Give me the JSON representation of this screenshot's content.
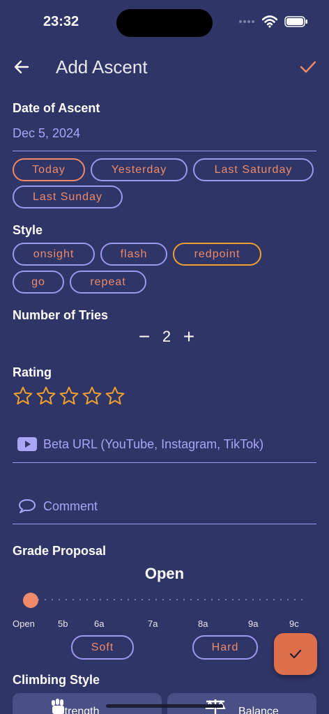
{
  "status_bar": {
    "time": "23:32"
  },
  "app_bar": {
    "title": "Add Ascent"
  },
  "date_section": {
    "label": "Date of Ascent",
    "value": "Dec 5, 2024",
    "chips": [
      "Today",
      "Yesterday",
      "Last Saturday",
      "Last Sunday"
    ],
    "selected": "Today"
  },
  "style_section": {
    "label": "Style",
    "chips": [
      "onsight",
      "flash",
      "redpoint",
      "go",
      "repeat"
    ],
    "selected": "redpoint"
  },
  "tries_section": {
    "label": "Number of Tries",
    "decrement": "−",
    "value": "2",
    "increment": "+"
  },
  "rating_section": {
    "label": "Rating",
    "stars_total": 5,
    "stars_filled": 0
  },
  "beta_url": {
    "placeholder": "Beta URL (YouTube, Instagram, TikTok)",
    "icon": "youtube-icon"
  },
  "comment": {
    "placeholder": "Comment",
    "icon": "comment-icon"
  },
  "grade_proposal": {
    "label": "Grade Proposal",
    "current": "Open",
    "ticks": [
      "Open",
      "5b",
      "6a",
      "7a",
      "8a",
      "9a",
      "9c"
    ],
    "soft_label": "Soft",
    "hard_label": "Hard"
  },
  "climbing_style": {
    "label": "Climbing Style",
    "options": [
      "Strength",
      "Balance"
    ]
  },
  "colors": {
    "background": "#2f3566",
    "accent": "#ef8a6a",
    "outline": "#9d97ee",
    "star": "#f0a030",
    "fab": "#de6f4d"
  }
}
